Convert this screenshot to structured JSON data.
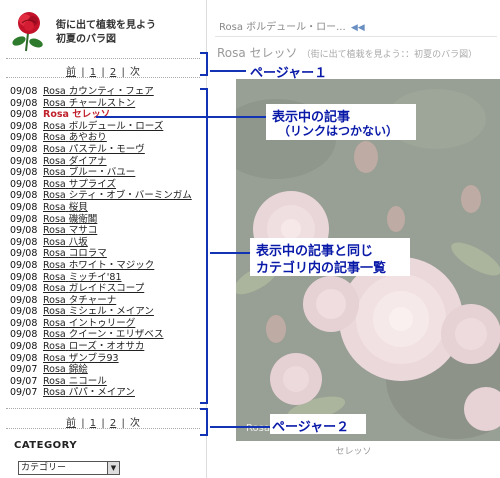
{
  "site": {
    "title_line1": "街に出て植栽を見よう",
    "title_line2": "初夏のバラ図"
  },
  "pager_top": {
    "prev": "前",
    "sep1": "|",
    "page1": "1",
    "sep2": "|",
    "page2": "2",
    "sep3": "|",
    "next": "次"
  },
  "pager_bottom": {
    "prev": "前",
    "sep1": "|",
    "page1": "1",
    "sep2": "|",
    "page2": "2",
    "sep3": "|",
    "next": "次"
  },
  "articles": [
    {
      "date": "09/08",
      "prefix": "Rosa",
      "name": "カウンティ・フェア",
      "current": false
    },
    {
      "date": "09/08",
      "prefix": "Rosa",
      "name": "チャールストン",
      "current": false
    },
    {
      "date": "09/08",
      "prefix": "Rosa",
      "name": "セレッソ",
      "current": true
    },
    {
      "date": "09/08",
      "prefix": "Rosa",
      "name": "ボルデュール・ローズ",
      "current": false
    },
    {
      "date": "09/08",
      "prefix": "Rosa",
      "name": "あやおり",
      "current": false
    },
    {
      "date": "09/08",
      "prefix": "Rosa",
      "name": "パステル・モーヴ",
      "current": false
    },
    {
      "date": "09/08",
      "prefix": "Rosa",
      "name": "ダイアナ",
      "current": false
    },
    {
      "date": "09/08",
      "prefix": "Rosa",
      "name": "ブルー・バユー",
      "current": false
    },
    {
      "date": "09/08",
      "prefix": "Rosa",
      "name": "サプライズ",
      "current": false
    },
    {
      "date": "09/08",
      "prefix": "Rosa",
      "name": "シティ・オブ・バーミンガム",
      "current": false
    },
    {
      "date": "09/08",
      "prefix": "Rosa",
      "name": "桜貝",
      "current": false
    },
    {
      "date": "09/08",
      "prefix": "Rosa",
      "name": "磯衛閣",
      "current": false
    },
    {
      "date": "09/08",
      "prefix": "Rosa",
      "name": "マサコ",
      "current": false
    },
    {
      "date": "09/08",
      "prefix": "Rosa",
      "name": "八坂",
      "current": false
    },
    {
      "date": "09/08",
      "prefix": "Rosa",
      "name": "コロラマ",
      "current": false
    },
    {
      "date": "09/08",
      "prefix": "Rosa",
      "name": "ホワイト・マジック",
      "current": false
    },
    {
      "date": "09/08",
      "prefix": "Rosa",
      "name": "ミッチイ'81",
      "current": false
    },
    {
      "date": "09/08",
      "prefix": "Rosa",
      "name": "ガレイドスコープ",
      "current": false
    },
    {
      "date": "09/08",
      "prefix": "Rosa",
      "name": "タチャーナ",
      "current": false
    },
    {
      "date": "09/08",
      "prefix": "Rosa",
      "name": "ミシェル・メイアン",
      "current": false
    },
    {
      "date": "09/08",
      "prefix": "Rosa",
      "name": "イントゥリーグ",
      "current": false
    },
    {
      "date": "09/08",
      "prefix": "Rosa",
      "name": "クイーン・エリザベス",
      "current": false
    },
    {
      "date": "09/08",
      "prefix": "Rosa",
      "name": "ローズ・オオサカ",
      "current": false
    },
    {
      "date": "09/08",
      "prefix": "Rosa",
      "name": "ザンブラ93",
      "current": false
    },
    {
      "date": "09/07",
      "prefix": "Rosa",
      "name": "錦絵",
      "current": false
    },
    {
      "date": "09/07",
      "prefix": "Rosa",
      "name": "ニコール",
      "current": false
    },
    {
      "date": "09/07",
      "prefix": "Rosa",
      "name": "パパ・メイアン",
      "current": false
    }
  ],
  "category": {
    "heading": "CATEGORY",
    "selected": "カテゴリー"
  },
  "main": {
    "breadcrumb": "Rosa ボルデュール・ロー...",
    "breadcrumb_icon": "double-left-arrow-icon",
    "post_title": "Rosa セレッソ",
    "post_subtitle": "（街に出て植栽を見よう：：初夏のバラ図）",
    "photo_caption": "セレッソ",
    "photo_watermark": "Rosa"
  },
  "annotations": {
    "pager1": "ページャー１",
    "current_line1": "表示中の記事",
    "current_line2": "（リンクはつかない）",
    "list_line1": "表示中の記事と同じ",
    "list_line2": "カテゴリ内の記事一覧",
    "pager2": "ページャー２"
  },
  "colors": {
    "accent_annotation": "#0a1aa8",
    "current_article": "#c0202a",
    "link": "#222222"
  }
}
